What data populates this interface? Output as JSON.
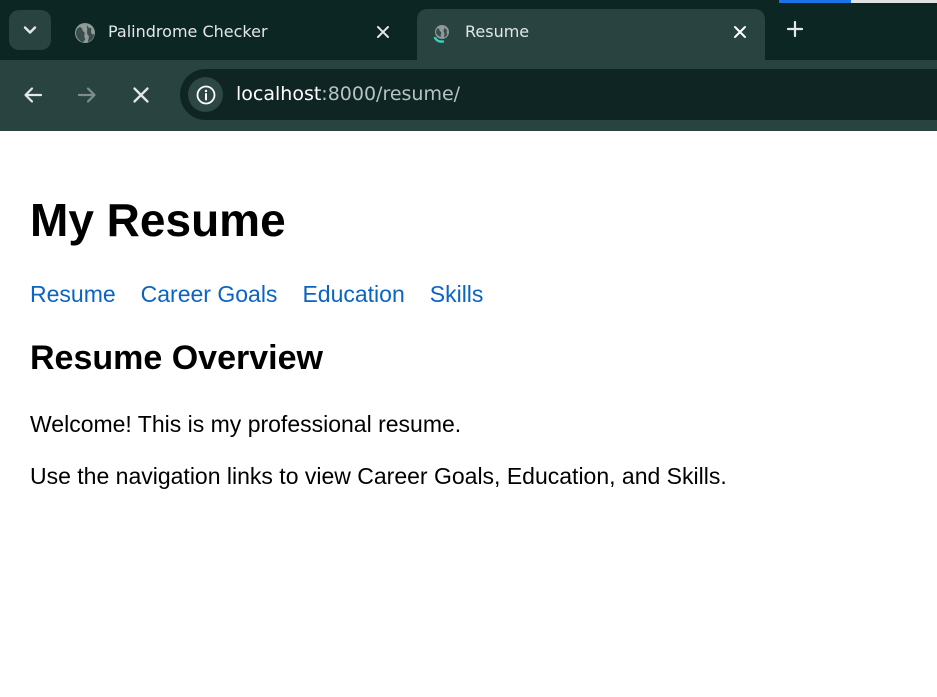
{
  "browser": {
    "tabs": [
      {
        "title": "Palindrome Checker",
        "favicon": "globe-icon",
        "active": false
      },
      {
        "title": "Resume",
        "favicon": "loading-globe-icon",
        "active": true
      }
    ],
    "address": {
      "host": "localhost",
      "rest": ":8000/resume/"
    },
    "colors": {
      "chrome_dark": "#0c2624",
      "chrome_toolbar": "#284340",
      "link": "#0b63c4"
    }
  },
  "page": {
    "title": "My Resume",
    "nav": [
      "Resume",
      "Career Goals",
      "Education",
      "Skills"
    ],
    "section_heading": "Resume Overview",
    "paragraphs": [
      "Welcome! This is my professional resume.",
      "Use the navigation links to view Career Goals, Education, and Skills."
    ]
  }
}
